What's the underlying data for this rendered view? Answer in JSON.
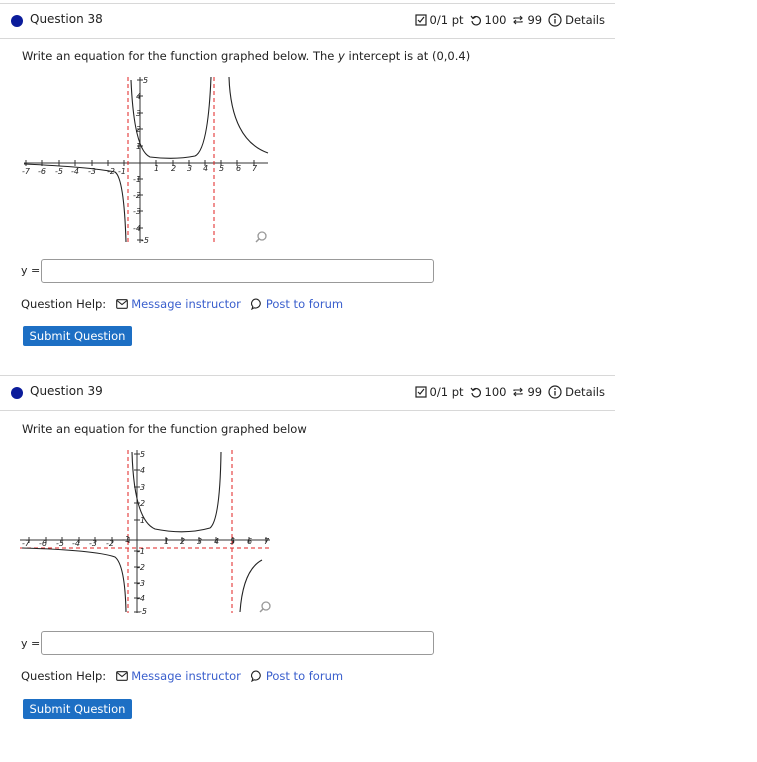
{
  "questions": [
    {
      "title": "Question 38",
      "score": "0/1 pt",
      "retries": "100",
      "attempts": "99",
      "details": "Details",
      "prompt_parts": [
        "Write an equation for the function graphed below. The ",
        "y",
        " intercept is at (0,0.4)"
      ],
      "answer_label": "y =",
      "help_label": "Question Help:",
      "message_label": "Message instructor",
      "forum_label": "Post to forum",
      "submit_label": "Submit Question"
    },
    {
      "title": "Question 39",
      "score": "0/1 pt",
      "retries": "100",
      "attempts": "99",
      "details": "Details",
      "prompt_parts": [
        "Write an equation for the function graphed below",
        "",
        ""
      ],
      "answer_label": "y =",
      "help_label": "Question Help:",
      "message_label": "Message instructor",
      "forum_label": "Post to forum",
      "submit_label": "Submit Question"
    }
  ],
  "graphs": {
    "x_tick_labels": [
      "-7",
      "-6",
      "-5",
      "-4",
      "-3",
      "-2",
      "-1",
      "1",
      "2",
      "3",
      "4",
      "5",
      "6",
      "7"
    ],
    "y_tick_labels": [
      "5",
      "4",
      "3",
      "2",
      "1",
      "-1",
      "-2",
      "-3",
      "-4",
      "-5"
    ],
    "zoom_icon": "magnifier-icon",
    "asymptote_color": "#e02020",
    "curve_color": "#222222"
  }
}
